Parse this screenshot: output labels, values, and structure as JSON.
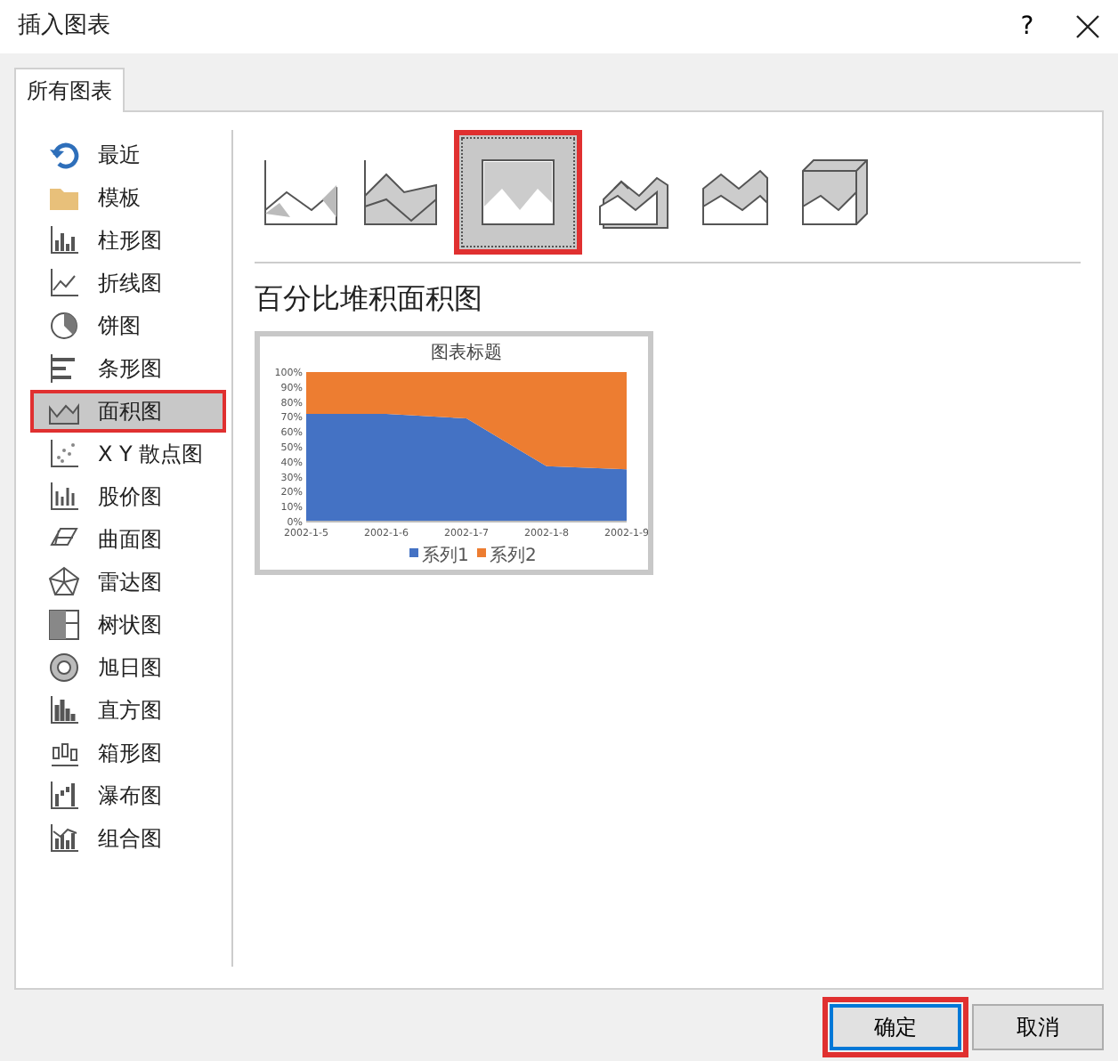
{
  "window": {
    "title": "插入图表",
    "help": "?"
  },
  "tabs": [
    {
      "label": "所有图表",
      "selected": true
    }
  ],
  "sidebar": {
    "items": [
      {
        "label": "最近",
        "selected": false
      },
      {
        "label": "模板",
        "selected": false
      },
      {
        "label": "柱形图",
        "selected": false
      },
      {
        "label": "折线图",
        "selected": false
      },
      {
        "label": "饼图",
        "selected": false
      },
      {
        "label": "条形图",
        "selected": false
      },
      {
        "label": "面积图",
        "selected": true
      },
      {
        "label": "X Y 散点图",
        "selected": false
      },
      {
        "label": "股价图",
        "selected": false
      },
      {
        "label": "曲面图",
        "selected": false
      },
      {
        "label": "雷达图",
        "selected": false
      },
      {
        "label": "树状图",
        "selected": false
      },
      {
        "label": "旭日图",
        "selected": false
      },
      {
        "label": "直方图",
        "selected": false
      },
      {
        "label": "箱形图",
        "selected": false
      },
      {
        "label": "瀑布图",
        "selected": false
      },
      {
        "label": "组合图",
        "selected": false
      }
    ]
  },
  "subtypes": [
    {
      "selected": false
    },
    {
      "selected": false
    },
    {
      "selected": true
    },
    {
      "selected": false
    },
    {
      "selected": false
    },
    {
      "selected": false
    }
  ],
  "subtype_title": "百分比堆积面积图",
  "preview": {
    "chart_data": {
      "type": "area",
      "stacked": true,
      "legend": "bottom",
      "title": "图表标题",
      "categories": [
        "2002-1-5",
        "2002-1-6",
        "2002-1-7",
        "2002-1-8",
        "2002-1-9"
      ],
      "series": [
        {
          "name": "系列1",
          "color": "#4472c4",
          "values": [
            72,
            72,
            69,
            37,
            35
          ]
        },
        {
          "name": "系列2",
          "color": "#ed7d31",
          "values": [
            28,
            28,
            31,
            63,
            65
          ]
        }
      ],
      "ylim": [
        0,
        100
      ],
      "yticks": [
        {
          "value": 0,
          "label": "0%"
        },
        {
          "value": 10,
          "label": "10%"
        },
        {
          "value": 20,
          "label": "20%"
        },
        {
          "value": 30,
          "label": "30%"
        },
        {
          "value": 40,
          "label": "40%"
        },
        {
          "value": 50,
          "label": "50%"
        },
        {
          "value": 60,
          "label": "60%"
        },
        {
          "value": 70,
          "label": "70%"
        },
        {
          "value": 80,
          "label": "80%"
        },
        {
          "value": 90,
          "label": "90%"
        },
        {
          "value": 100,
          "label": "100%"
        }
      ]
    }
  },
  "buttons": [
    {
      "label": "确定",
      "highlighted": true
    },
    {
      "label": "取消",
      "highlighted": false
    }
  ]
}
